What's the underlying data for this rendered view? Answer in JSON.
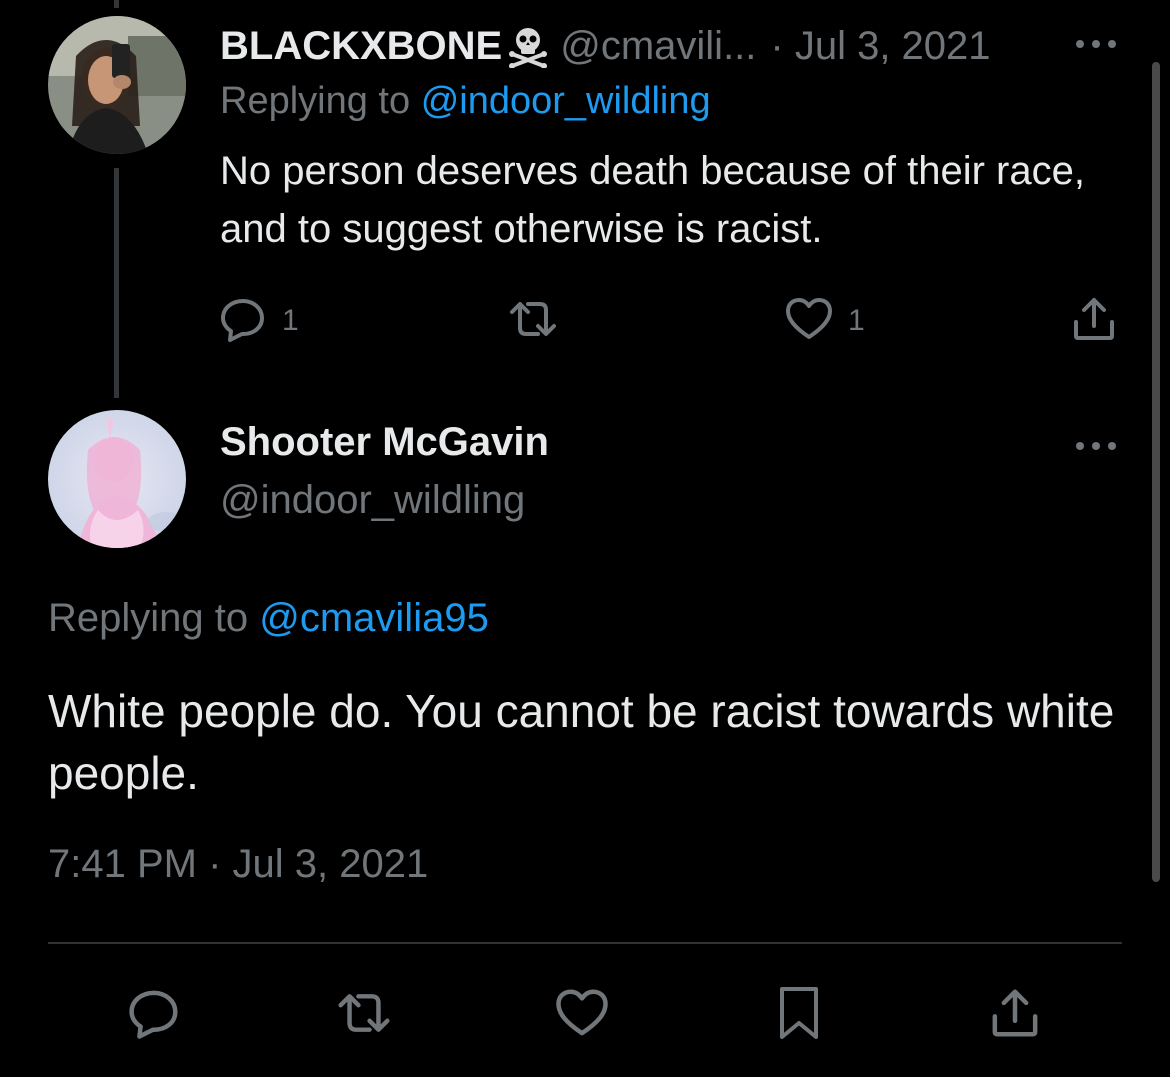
{
  "parent_tweet": {
    "display_name": "BLACKXBONE",
    "handle": "@cmavili...",
    "date": "· Jul 3, 2021",
    "replying_prefix": "Replying to",
    "replying_to": "@indoor_wildling",
    "text": "No person deserves death because of their race, and to suggest otherwise is racist.",
    "reply_count": "1",
    "like_count": "1",
    "icons": [
      "skull-crossbones-icon",
      "more-icon",
      "reply-icon",
      "retweet-icon",
      "like-icon",
      "share-icon"
    ]
  },
  "main_tweet": {
    "display_name": "Shooter McGavin",
    "handle": "@indoor_wildling",
    "replying_prefix": "Replying to",
    "replying_to": "@cmavilia95",
    "text": "White people do. You cannot be racist towards white people.",
    "timestamp": "7:41 PM · Jul 3, 2021",
    "icons": [
      "more-icon",
      "reply-icon",
      "retweet-icon",
      "like-icon",
      "bookmark-icon",
      "share-icon"
    ]
  },
  "colors": {
    "background": "#000000",
    "text": "#e7e9ea",
    "muted": "#71767b",
    "link": "#1d9bf0",
    "divider": "#2f3336"
  }
}
